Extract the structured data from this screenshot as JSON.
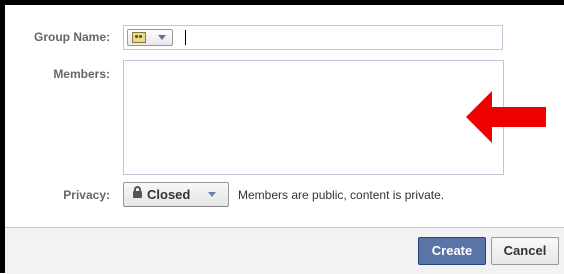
{
  "labels": {
    "group_name": "Group Name:",
    "members": "Members:",
    "privacy": "Privacy:"
  },
  "group_name_field": {
    "value": "",
    "placeholder": ""
  },
  "members_field": {
    "value": ""
  },
  "privacy": {
    "selected": "Closed",
    "description": "Members are public, content is private."
  },
  "buttons": {
    "create": "Create",
    "cancel": "Cancel"
  },
  "colors": {
    "primary_button": "#5b74a8",
    "annotation_arrow": "#ee0000"
  },
  "icons": {
    "group_icon": "group-icon",
    "lock": "lock-icon",
    "dropdown": "chevron-down-icon",
    "annotation": "red-arrow-icon"
  }
}
